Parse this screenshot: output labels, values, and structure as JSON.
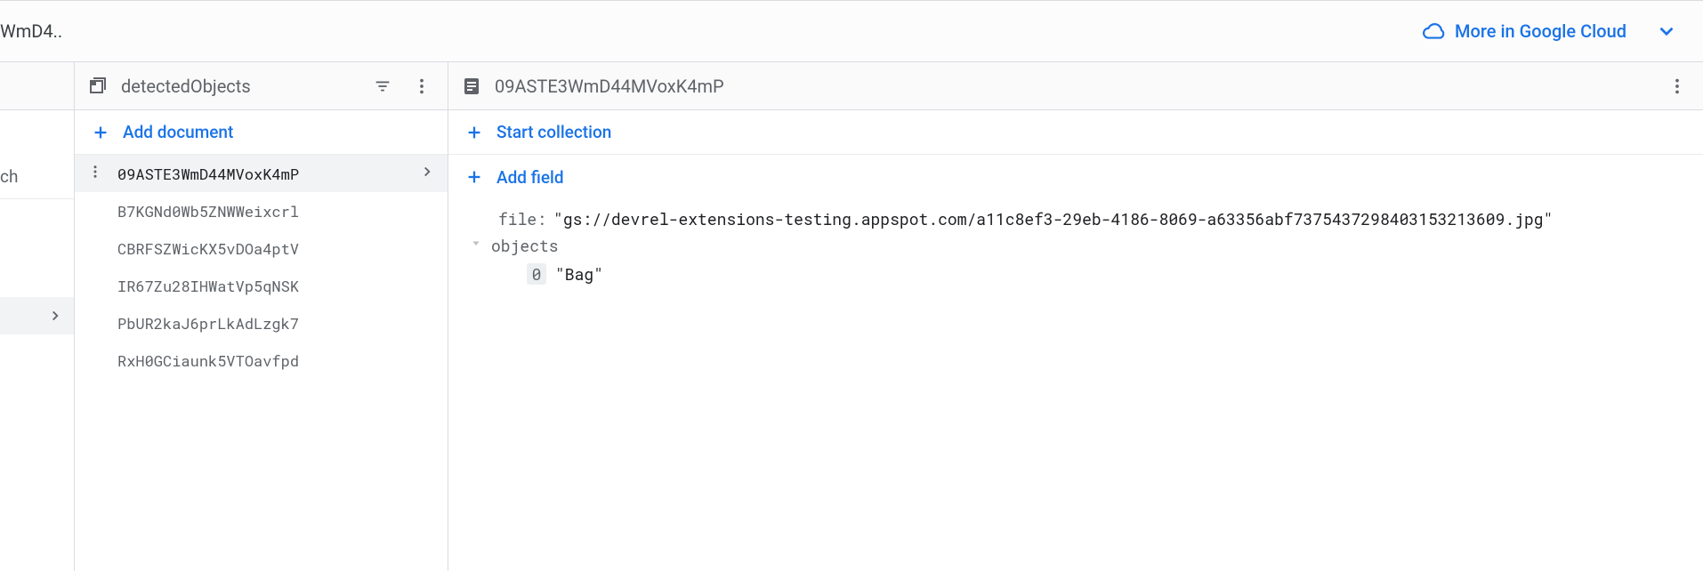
{
  "topbar": {
    "breadcrumb_tail": "WmD4..",
    "cloud_link": "More in Google Cloud"
  },
  "left": {
    "peek_label": "ch"
  },
  "collection_pane": {
    "title": "detectedObjects",
    "add_label": "Add document",
    "documents": [
      "09ASTE3WmD44MVoxK4mP",
      "B7KGNd0Wb5ZNWWeixcrl",
      "CBRFSZWicKX5vDOa4ptV",
      "IR67Zu28IHWatVp5qNSK",
      "PbUR2kaJ6prLkAdLzgk7",
      "RxH0GCiaunk5VTOavfpd"
    ],
    "selected_index": 0
  },
  "document_pane": {
    "title": "09ASTE3WmD44MVoxK4mP",
    "start_collection_label": "Start collection",
    "add_field_label": "Add field",
    "fields": {
      "file_key": "file",
      "file_value": "\"gs://devrel-extensions-testing.appspot.com/a11c8ef3-29eb-4186-8069-a63356abf7375437298403153213609.jpg\"",
      "objects_key": "objects",
      "objects_items": [
        {
          "index": "0",
          "value": "\"Bag\""
        }
      ]
    }
  }
}
